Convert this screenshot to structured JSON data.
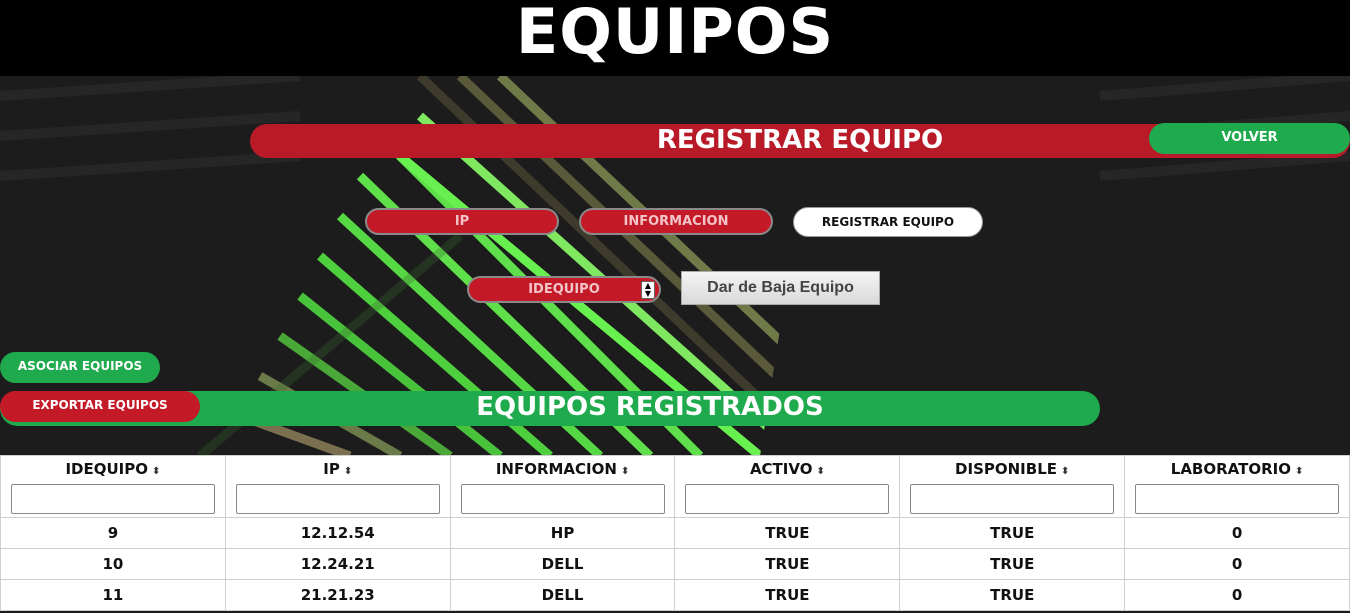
{
  "header": {
    "title": "EQUIPOS"
  },
  "register_bar": {
    "title": "REGISTRAR EQUIPO",
    "back_label": "VOLVER"
  },
  "form": {
    "ip_label": "IP",
    "info_label": "INFORMACION",
    "register_label": "REGISTRAR EQUIPO",
    "select_value": "IDEQUIPO",
    "delete_label": "Dar de Baja Equipo"
  },
  "actions": {
    "associate_label": "ASOCIAR EQUIPOS",
    "export_label": "EXPORTAR EQUIPOS"
  },
  "registered_bar": {
    "title": "EQUIPOS REGISTRADOS"
  },
  "table": {
    "columns": [
      "IDEQUIPO",
      "IP",
      "INFORMACION",
      "ACTIVO",
      "DISPONIBLE",
      "LABORATORIO"
    ],
    "rows": [
      [
        "9",
        "12.12.54",
        "HP",
        "TRUE",
        "TRUE",
        "0"
      ],
      [
        "10",
        "12.24.21",
        "DELL",
        "TRUE",
        "TRUE",
        "0"
      ],
      [
        "11",
        "21.21.23",
        "DELL",
        "TRUE",
        "TRUE",
        "0"
      ]
    ]
  },
  "colors": {
    "red": "#b81a28",
    "green": "#1fab4d",
    "black": "#000000"
  },
  "icons": {
    "sort": "sort-icon",
    "select_arrows": "spinner-icon"
  }
}
